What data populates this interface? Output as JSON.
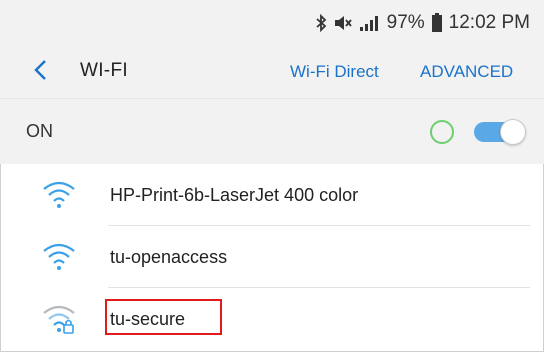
{
  "status_bar": {
    "battery": "97%",
    "time": "12:02 PM",
    "icons": [
      "bluetooth-icon",
      "mute-icon",
      "signal-icon",
      "battery-icon"
    ]
  },
  "header": {
    "title": "WI-FI",
    "wifi_direct_label": "Wi-Fi Direct",
    "advanced_label": "ADVANCED",
    "accent_color": "#1a73c9"
  },
  "wifi_toggle": {
    "label": "ON",
    "state": "on",
    "color": "#5aa8e6"
  },
  "networks": [
    {
      "name": "HP-Print-6b-LaserJet 400 color",
      "secured": false,
      "icon": "wifi-icon",
      "color": "#3aa0e8"
    },
    {
      "name": "tu-openaccess",
      "secured": false,
      "icon": "wifi-icon",
      "color": "#3aa0e8"
    },
    {
      "name": "tu-secure",
      "secured": true,
      "icon": "wifi-lock-icon",
      "color": "#9aa0a6",
      "highlighted": true
    }
  ]
}
